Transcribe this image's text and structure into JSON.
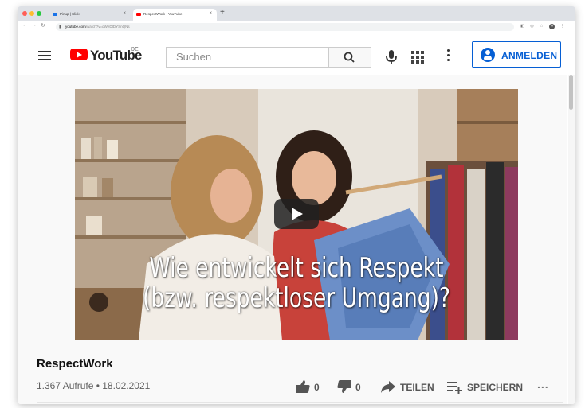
{
  "browser": {
    "tabs": [
      {
        "title": "Pinup | Slick",
        "favicon_color": "#1a73e8",
        "active": false
      },
      {
        "title": "RespectWork - YouTube",
        "favicon_color": "#ff0000",
        "active": true
      }
    ],
    "address": {
      "host": "youtube.com",
      "path": "/watch?v=dWeDIDYSnQNs"
    }
  },
  "header": {
    "logo_text": "YouTube",
    "region": "DE",
    "search_placeholder": "Suchen",
    "signin_label": "ANMELDEN"
  },
  "video": {
    "caption_line1": "Wie entwickelt sich Respekt",
    "caption_line2": "(bzw. respektloser Umgang)?"
  },
  "info": {
    "channel_title": "RespectWork",
    "meta": "1.367 Aufrufe • 18.02.2021",
    "likes": "0",
    "dislikes": "0",
    "share_label": "TEILEN",
    "save_label": "SPEICHERN",
    "more": "..."
  },
  "colors": {
    "brand_red": "#ff0000",
    "accent_blue": "#065fd4"
  }
}
